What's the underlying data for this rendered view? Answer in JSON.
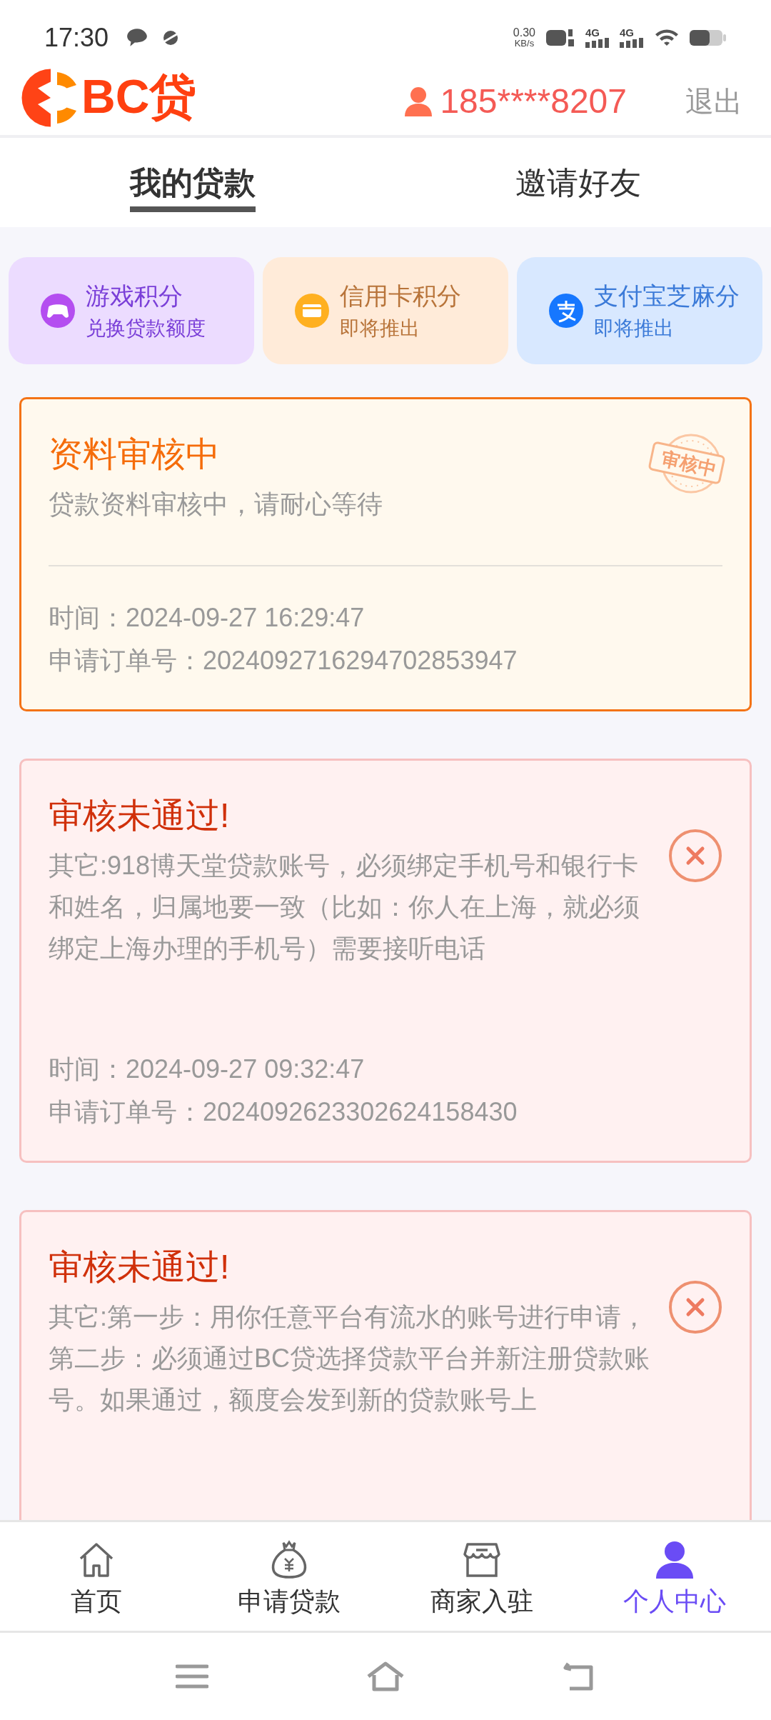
{
  "status_bar": {
    "time": "17:30",
    "net_speed": "0.30",
    "net_unit": "KB/s",
    "network_labels": [
      "4G",
      "4G"
    ]
  },
  "header": {
    "logo": "BC贷",
    "phone": "185****8207",
    "logout": "退出"
  },
  "tabs": [
    {
      "label": "我的贷款",
      "selected": true
    },
    {
      "label": "邀请好友",
      "selected": false
    }
  ],
  "promos": [
    {
      "kind": "game",
      "title": "游戏积分",
      "subtitle": "兑换贷款额度"
    },
    {
      "kind": "card",
      "title": "信用卡积分",
      "subtitle": "即将推出"
    },
    {
      "kind": "alipay",
      "title": "支付宝芝麻分",
      "subtitle": "即将推出"
    }
  ],
  "applications": [
    {
      "kind": "pending",
      "title": "资料审核中",
      "message": "贷款资料审核中，请耐心等待",
      "stamp": "审核中",
      "time_label": "时间：",
      "time": "2024-09-27 16:29:47",
      "order_label": "申请订单号：",
      "order": "2024092716294702853947"
    },
    {
      "kind": "rejected",
      "title": "审核未通过!",
      "message": "其它:918博天堂贷款账号，必须绑定手机号和银行卡和姓名，归属地要一致（比如：你人在上海，就必须绑定上海办理的手机号）需要接听电话",
      "time_label": "时间：",
      "time": "2024-09-27 09:32:47",
      "order_label": "申请订单号：",
      "order": "2024092623302624158430"
    },
    {
      "kind": "rejected",
      "title": "审核未通过!",
      "message": "其它:第一步：用你任意平台有流水的账号进行申请，第二步：必须通过BC贷选择贷款平台并新注册贷款账号。如果通过，额度会发到新的贷款账号上"
    }
  ],
  "bottom_nav": [
    {
      "kind": "home",
      "label": "首页",
      "selected": false
    },
    {
      "kind": "loan",
      "label": "申请贷款",
      "selected": false
    },
    {
      "kind": "shop",
      "label": "商家入驻",
      "selected": false
    },
    {
      "kind": "profile",
      "label": "个人中心",
      "selected": true
    }
  ]
}
